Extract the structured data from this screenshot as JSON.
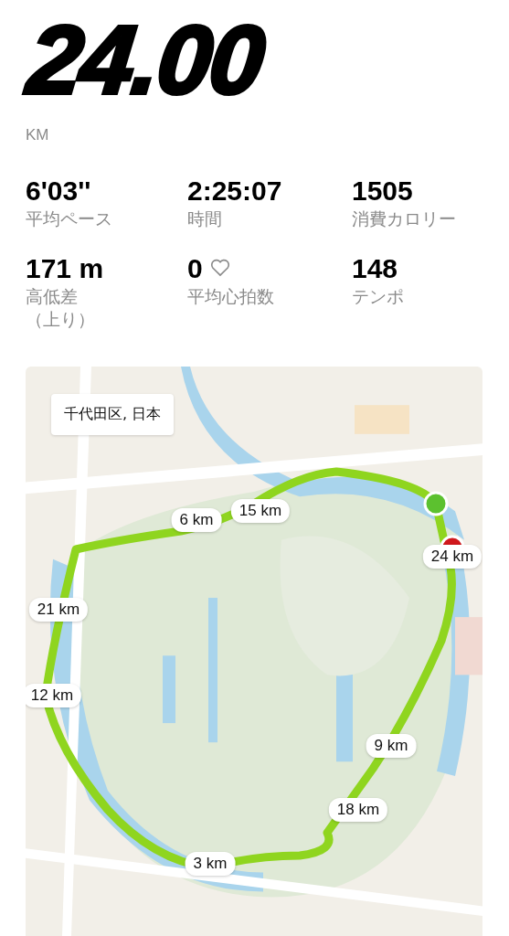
{
  "distance": {
    "value": "24.00",
    "unit": "KM"
  },
  "stats": [
    {
      "value": "6'03''",
      "label": "平均ペース"
    },
    {
      "value": "2:25:07",
      "label": "時間"
    },
    {
      "value": "1505",
      "label": "消費カロリー"
    },
    {
      "value": "171 m",
      "label": "高低差（上り）"
    },
    {
      "value": "0",
      "label": "平均心拍数",
      "heart": true
    },
    {
      "value": "148",
      "label": "テンポ"
    }
  ],
  "map": {
    "location": "千代田区, 日本",
    "markers": [
      "6 km",
      "15 km",
      "24 km",
      "21 km",
      "12 km",
      "9 km",
      "18 km",
      "3 km"
    ]
  }
}
